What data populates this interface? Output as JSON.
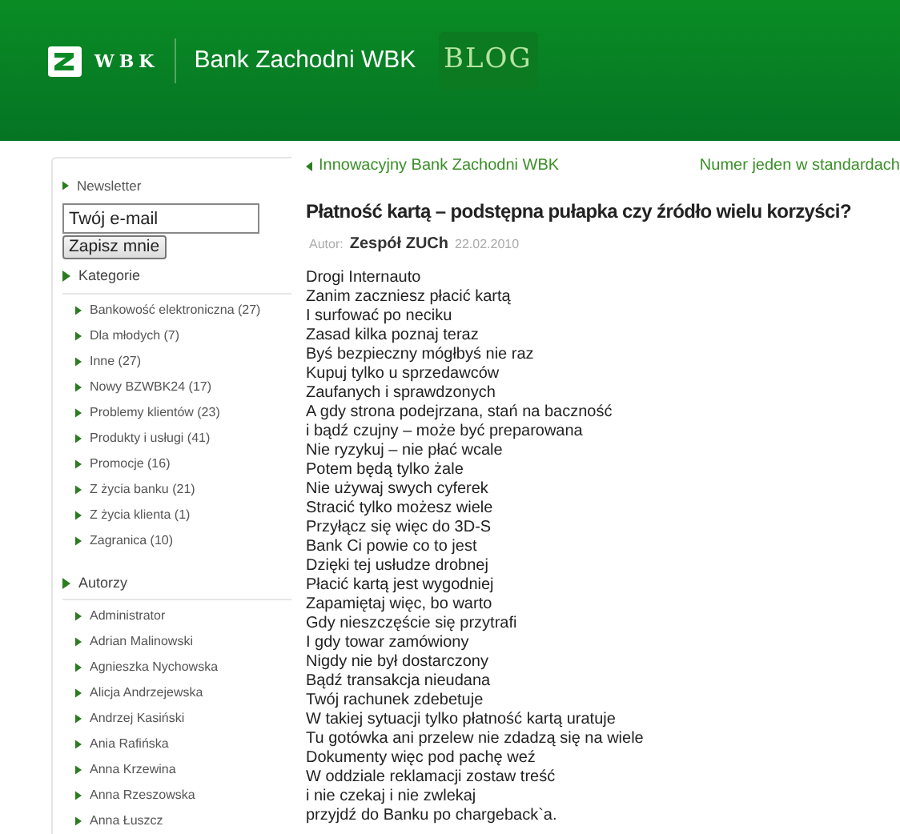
{
  "header": {
    "logo_text": "WBK",
    "bank_name": "Bank Zachodni WBK",
    "blog_label": "BLOG"
  },
  "sidebar": {
    "newsletter": {
      "heading": "Newsletter",
      "placeholder": "Twój e-mail",
      "button": "Zapisz mnie"
    },
    "sections": [
      {
        "heading": "Kategorie",
        "items": [
          "Bankowość elektroniczna (27)",
          "Dla młodych (7)",
          "Inne (27)",
          "Nowy BZWBK24 (17)",
          "Problemy klientów (23)",
          "Produkty i usługi (41)",
          "Promocje (16)",
          "Z życia banku (21)",
          "Z życia klienta (1)",
          "Zagranica (10)"
        ]
      },
      {
        "heading": "Autorzy",
        "items": [
          "Administrator",
          "Adrian Malinowski",
          "Agnieszka Nychowska",
          "Alicja Andrzejewska",
          "Andrzej Kasiński",
          "Ania Rafińska",
          "Anna Krzewina",
          "Anna Rzeszowska",
          "Anna Łuszcz"
        ]
      }
    ]
  },
  "post": {
    "prev_link": "Innowacyjny Bank Zachodni WBK",
    "next_link": "Numer jeden w standardach",
    "title": "Płatność kartą – podstępna pułapka czy źródło wielu korzyści?",
    "author_label": "Autor:",
    "author": "Zespół ZUCh",
    "date": "22.02.2010",
    "lines": [
      "Drogi Internauto",
      "Zanim zaczniesz płacić kartą",
      "I surfować po neciku",
      "Zasad kilka poznaj teraz",
      "Byś bezpieczny mógłbyś nie raz",
      "Kupuj tylko u sprzedawców",
      "Zaufanych i sprawdzonych",
      "A gdy strona podejrzana, stań na baczność",
      "i bądź czujny – może być preparowana",
      "Nie ryzykuj – nie płać wcale",
      "Potem będą tylko żale",
      "Nie używaj swych cyferek",
      "Stracić tylko możesz wiele",
      "Przyłącz się więc do 3D-S",
      "Bank Ci powie co to jest",
      "Dzięki tej usłudze drobnej",
      "Płacić kartą jest wygodniej",
      "Zapamiętaj więc, bo warto",
      "Gdy nieszczęście się przytrafi",
      "I gdy towar zamówiony",
      "Nigdy nie był dostarczony",
      "Bądź transakcja nieudana",
      "Twój rachunek zdebetuje",
      "W takiej sytuacji tylko płatność kartą uratuje",
      "Tu gotówka ani przelew nie zdadzą się na wiele",
      "Dokumenty więc pod pachę weź",
      "W oddziale reklamacji zostaw treść",
      "i nie czekaj i nie zwlekaj",
      "przyjdź do Banku po chargeback`a."
    ]
  }
}
